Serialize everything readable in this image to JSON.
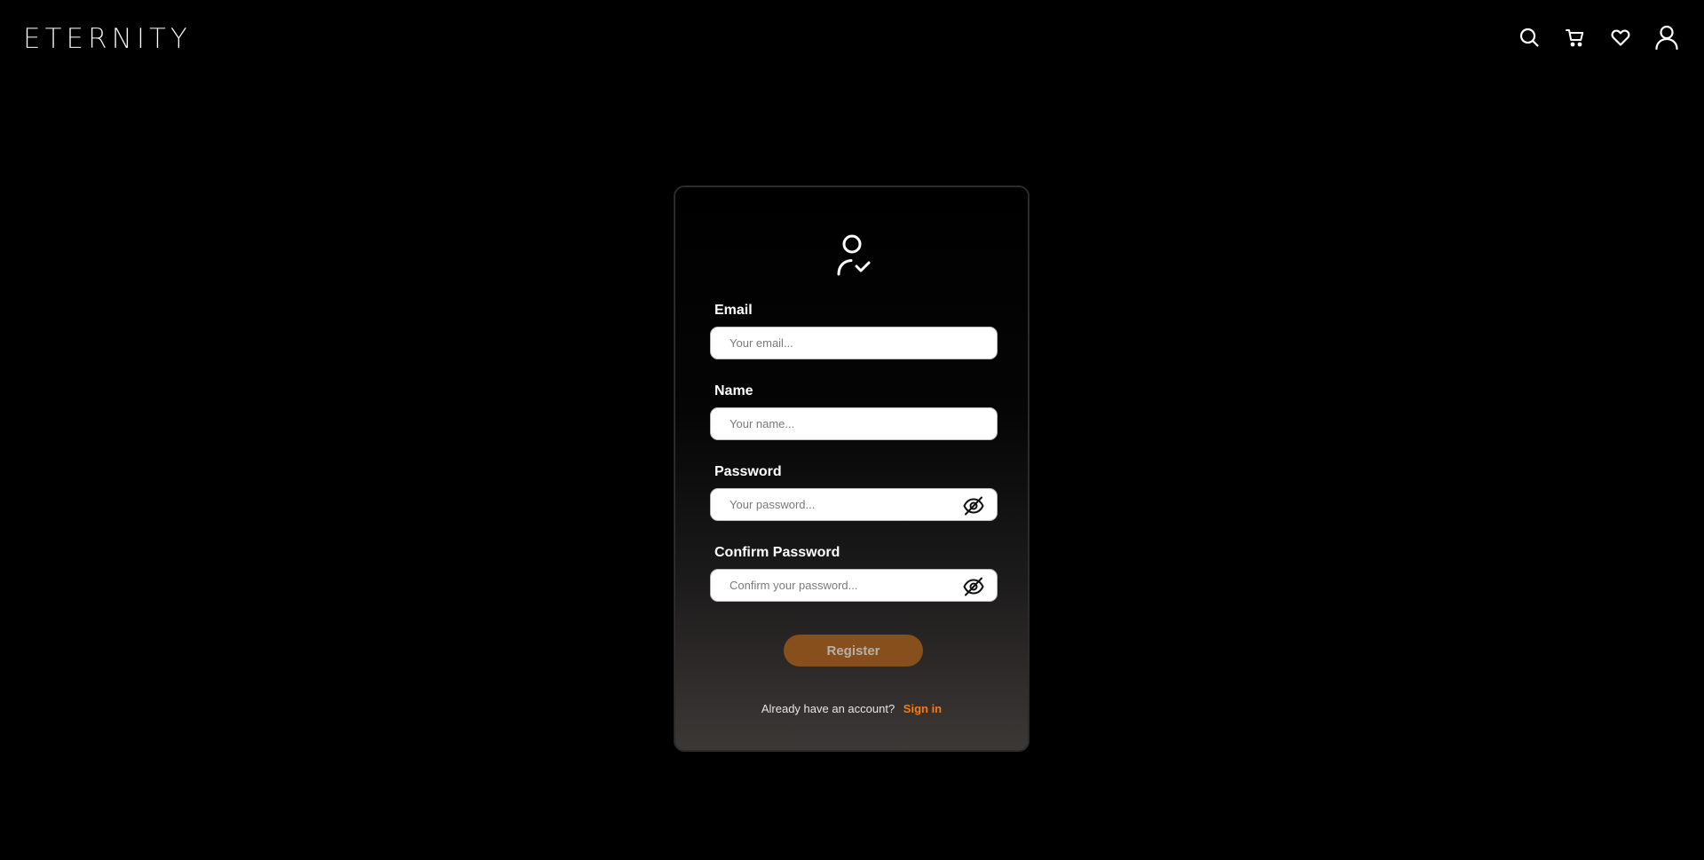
{
  "header": {
    "brand": "ETERNITY",
    "icons": [
      "search-icon",
      "cart-icon",
      "heart-icon",
      "user-icon"
    ]
  },
  "form": {
    "icon": "user-check-icon",
    "email": {
      "label": "Email",
      "placeholder": "Your email..."
    },
    "name": {
      "label": "Name",
      "placeholder": "Your name..."
    },
    "password": {
      "label": "Password",
      "placeholder": "Your password...",
      "toggle_icon": "eye-off-icon"
    },
    "confirm_password": {
      "label": "Confirm Password",
      "placeholder": "Confirm your password...",
      "toggle_icon": "eye-off-icon"
    },
    "register_label": "Register",
    "signin_prompt": "Already have an account?",
    "signin_link": "Sign in"
  },
  "colors": {
    "background": "#000000",
    "register_button": "#874f1c",
    "register_text": "#b8b0a8",
    "link": "#f07b18"
  }
}
